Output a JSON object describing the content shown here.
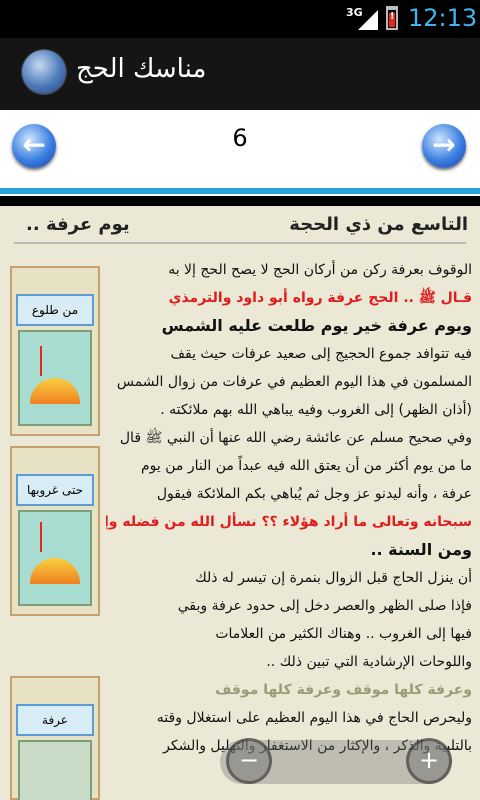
{
  "status": {
    "network": "3G",
    "time": "12:13",
    "battery_mark": "!"
  },
  "app": {
    "title": "مناسك الحج"
  },
  "nav": {
    "page_number": "6",
    "prev_glyph": "←",
    "next_glyph": "→"
  },
  "content": {
    "heading_right": "التاسع من ذي الحجة",
    "heading_left": "يوم عرفة ..",
    "sidebar": [
      {
        "label": "من طلوع الشمس"
      },
      {
        "label": "حتى غروبها"
      },
      {
        "label": "عرفة"
      }
    ],
    "lines": [
      "الوقوف بعرفة ركن من أركان الحج لا يصح الحج إلا به",
      "قـال ﷺ ..  الحج عرفة    رواه أبو داود والترمذي",
      "ويوم عرفة خير يوم طلعت عليه الشمس",
      "فيه تتوافد جموع الحجيج إلى صعيد عرفات حيث يقف",
      "المسلمون في هذا اليوم العظيم في عرفات من زوال الشمس",
      "(أذان الظهر) إلى الغروب وفيه يباهي الله بهم ملائكته .",
      "وفي صحيح مسلم عن عائشة رضي الله عنها أن النبي ﷺ قال",
      "ما من يوم أكثر من أن يعتق الله فيه عبداً من النار من يوم",
      "عرفة ، وأنه ليدنو عز وجل ثم يُباهي بكم الملائكة فيقول",
      "سبحانه وتعالى ما أراد هؤلاء ؟؟  نسأل الله من فضله وإحسانه",
      "ومن السنة ..",
      "أن ينزل الحاج قبل الزوال بنمرة إن تيسر له ذلك",
      "فإذا صلى الظهر والعصر دخل إلى حدود عرفة وبقي",
      "فيها إلى الغروب ..  وهناك الكثير من العلامات",
      "واللوحات الإرشادية التي تبين ذلك ..",
      "وعرفة كلها موقف     وعرفة كلها موقف",
      "وليحرص الحاج في هذا اليوم العظيم على استغلال وقته",
      "بالتلبية والذكر ، والإكثار من الاستغفار والتهليل والشكر"
    ]
  },
  "zoom": {
    "out_glyph": "−",
    "in_glyph": "+"
  },
  "colors": {
    "accent": "#2aa3dc",
    "time": "#3fb6f3",
    "paper": "#ece8d6"
  }
}
